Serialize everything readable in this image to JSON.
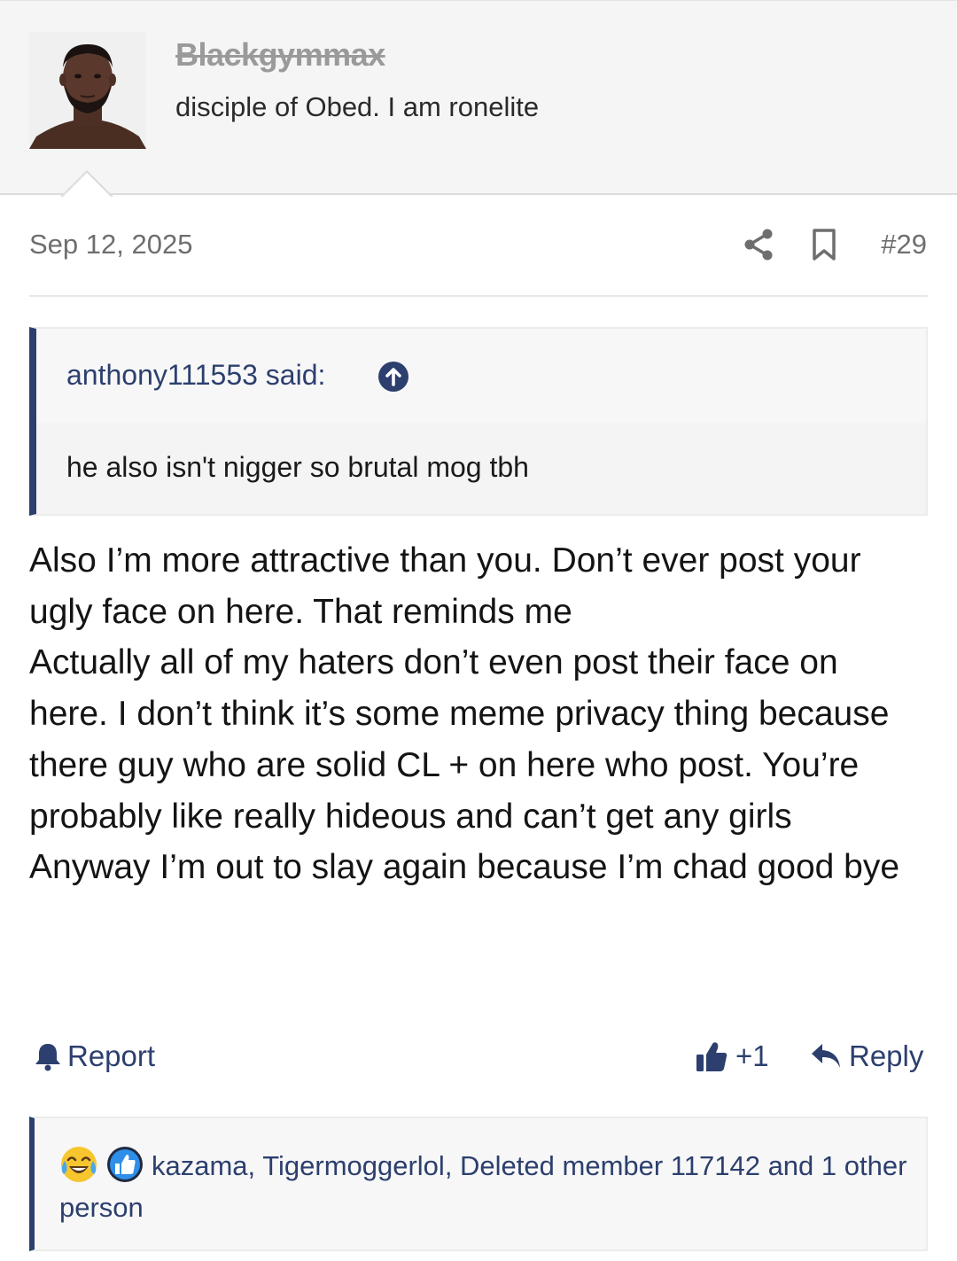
{
  "user": {
    "username": "Blackgymmax",
    "title": "disciple of Obed. I am ronelite"
  },
  "post": {
    "date": "Sep 12, 2025",
    "number": "#29",
    "quote": {
      "attribution": "anthony111553 said:",
      "text": "he also isn't nigger so brutal mog tbh"
    },
    "message": [
      "Also I’m more attractive than you. Don’t ever post your ugly face on here. That reminds me",
      "Actually all of my haters don’t even post their face on here. I don’t think it’s some meme privacy thing because there guy who are solid CL + on here who post. You’re probably like really hideous and can’t get any girls",
      "Anyway I’m out to slay again because I’m chad good bye"
    ]
  },
  "actions": {
    "report": "Report",
    "like": "+1",
    "reply": "Reply"
  },
  "reactions": {
    "icons": [
      "laughing-crying-emoji-icon",
      "thumbs-up-reaction-icon"
    ],
    "summary": "kazama, Tigermoggerlol, Deleted member 117142 and 1 other person"
  },
  "colors": {
    "accent": "#2c3f6e",
    "header_bg": "#f5f5f5",
    "muted": "#6e6e6e"
  }
}
